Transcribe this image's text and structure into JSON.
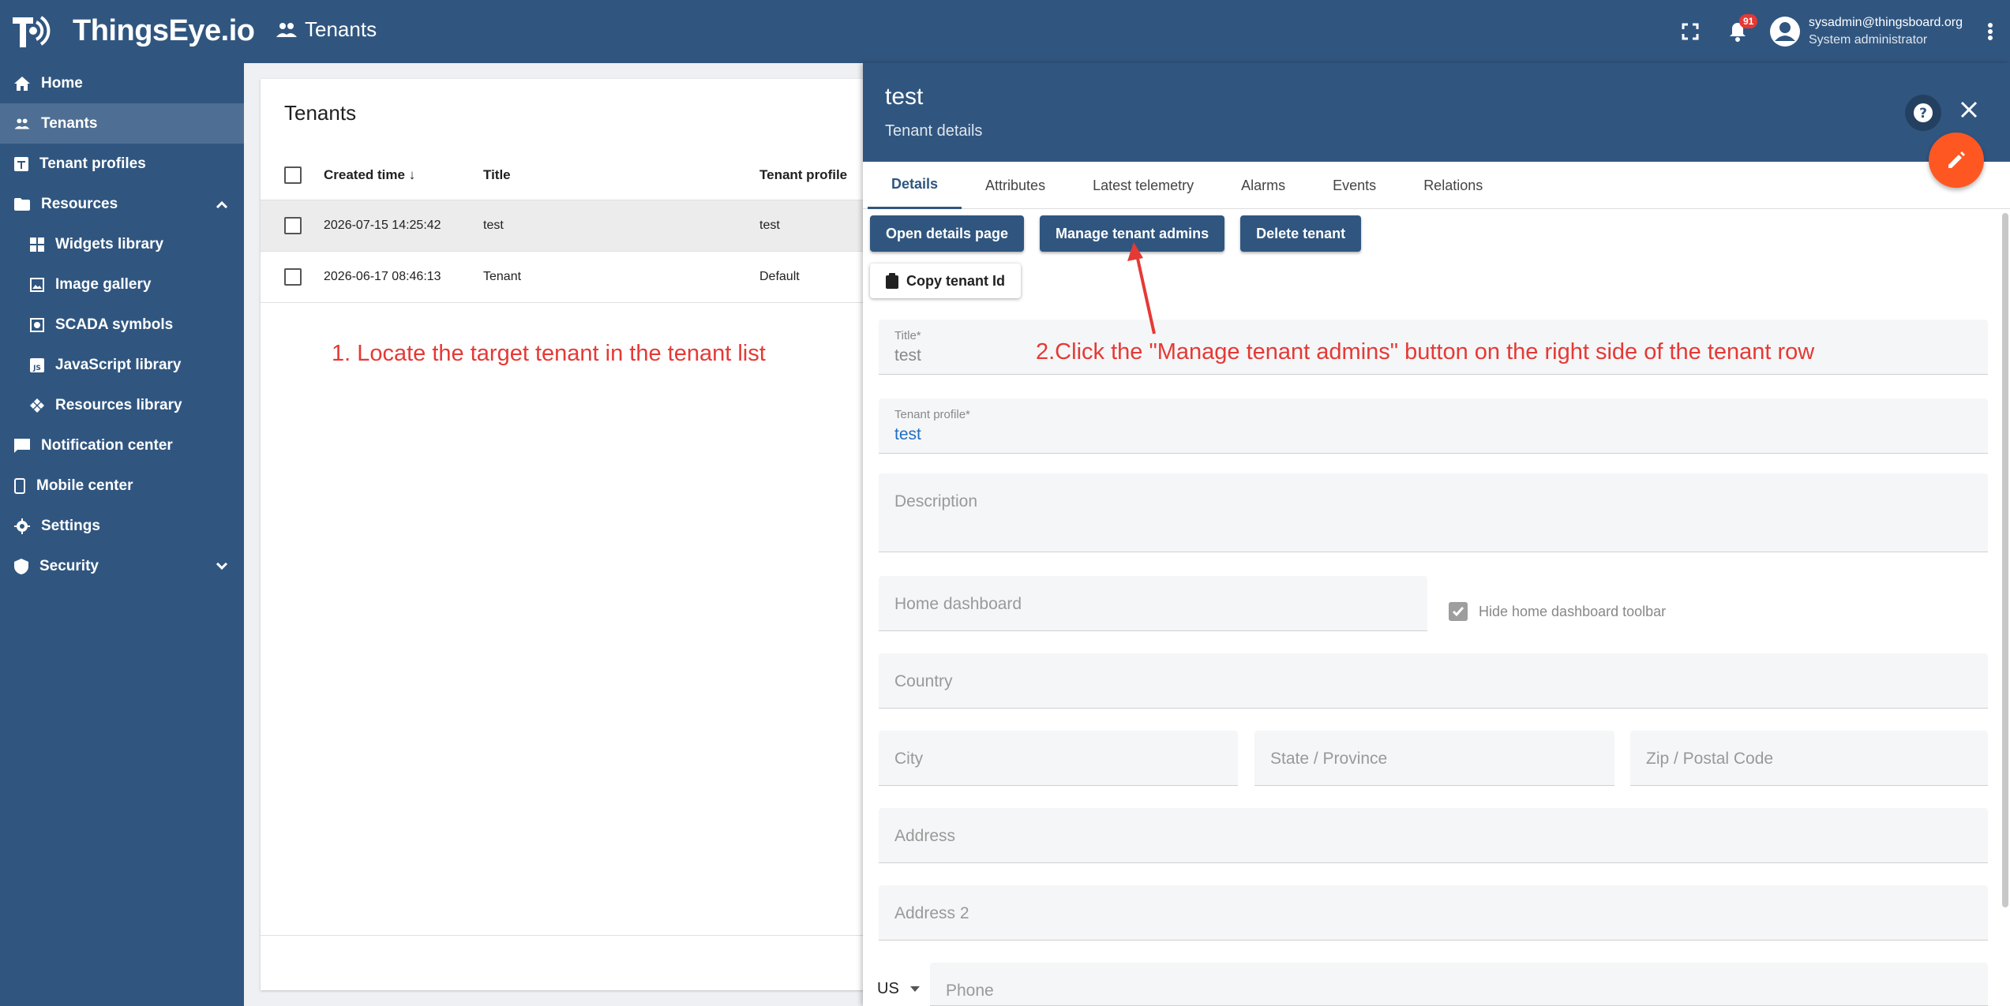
{
  "app": {
    "logo_text": "ThingsEye.io",
    "page_title": "Tenants"
  },
  "topbar": {
    "notification_count": "91",
    "user_email": "sysadmin@thingsboard.org",
    "user_role": "System administrator"
  },
  "sidebar": {
    "items": [
      {
        "label": "Home",
        "icon": "home-icon"
      },
      {
        "label": "Tenants",
        "icon": "people-icon"
      },
      {
        "label": "Tenant profiles",
        "icon": "tenant-profile-icon"
      },
      {
        "label": "Resources",
        "icon": "folder-icon"
      },
      {
        "label": "Widgets library",
        "icon": "widgets-icon"
      },
      {
        "label": "Image gallery",
        "icon": "image-icon"
      },
      {
        "label": "SCADA symbols",
        "icon": "scada-icon"
      },
      {
        "label": "JavaScript library",
        "icon": "javascript-icon"
      },
      {
        "label": "Resources library",
        "icon": "resources-icon"
      },
      {
        "label": "Notification center",
        "icon": "notification-icon"
      },
      {
        "label": "Mobile center",
        "icon": "mobile-icon"
      },
      {
        "label": "Settings",
        "icon": "gear-icon"
      },
      {
        "label": "Security",
        "icon": "shield-icon"
      }
    ]
  },
  "table": {
    "title": "Tenants",
    "headers": {
      "created": "Created time",
      "title": "Title",
      "profile": "Tenant profile"
    },
    "rows": [
      {
        "created": "2026-07-15 14:25:42",
        "title": "test",
        "profile": "test"
      },
      {
        "created": "2026-06-17 08:46:13",
        "title": "Tenant",
        "profile": "Default"
      }
    ]
  },
  "annotations": {
    "step1": "1. Locate the target tenant in the tenant list",
    "step2": "2.Click the \"Manage tenant admins\" button on the right side of the tenant row"
  },
  "details": {
    "title": "test",
    "subtitle": "Tenant details",
    "tabs": [
      "Details",
      "Attributes",
      "Latest telemetry",
      "Alarms",
      "Events",
      "Relations"
    ],
    "buttons": {
      "open": "Open details page",
      "manage": "Manage tenant admins",
      "delete": "Delete tenant",
      "copy": "Copy tenant Id"
    },
    "fields": {
      "title_label": "Title*",
      "title_value": "test",
      "profile_label": "Tenant profile*",
      "profile_value": "test",
      "description": "Description",
      "home_dashboard": "Home dashboard",
      "hide_toolbar": "Hide home dashboard toolbar",
      "country": "Country",
      "city": "City",
      "state": "State / Province",
      "zip": "Zip / Postal Code",
      "address": "Address",
      "address2": "Address 2",
      "phone_country": "US",
      "phone": "Phone"
    }
  },
  "colors": {
    "primary": "#305680",
    "accent": "#ff5722",
    "annotation": "#e53935"
  }
}
